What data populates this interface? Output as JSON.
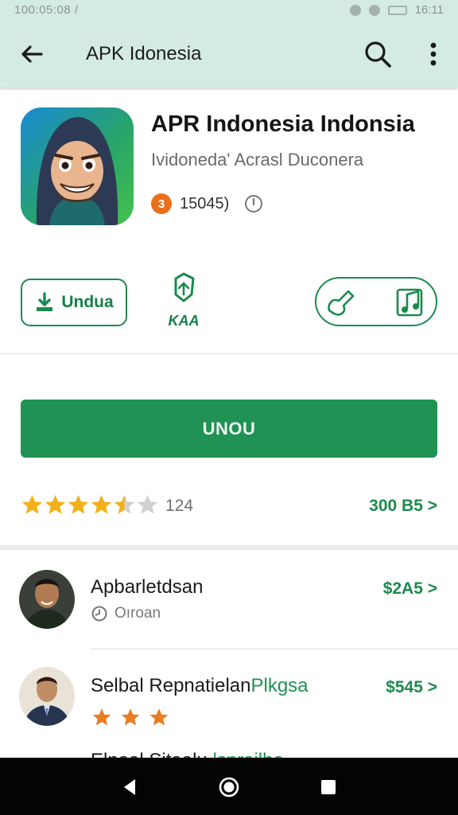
{
  "status_bar": {
    "left_text": "100:05:08  /",
    "time": "16:11"
  },
  "app_bar": {
    "title": "APK Idonesia",
    "icons": [
      "back-arrow-icon",
      "search-icon",
      "more-vert-icon"
    ]
  },
  "app": {
    "name": "APR Indonesia Indonsia",
    "developer": "Ividoneda' Acrasl Duconera",
    "age_badge": "3",
    "meta_text": "15045)",
    "colors": {
      "accent": "#1f9254",
      "age_badge": "#e9701b"
    }
  },
  "actions": {
    "download_label": "Undua",
    "mid_label": "KAA",
    "primary_button": "UNOU"
  },
  "rating": {
    "stars": 4.5,
    "count": "124",
    "link": "300 B5 >"
  },
  "reviews": [
    {
      "name": "Apbarletdsan",
      "sub": "Oıroan",
      "price": "$2A5 >"
    },
    {
      "name": "Selbal Repnatielan",
      "tag": "Plkgsa",
      "price": "$545 >",
      "stars": 3
    },
    {
      "name": "Elnaal Sitaalu",
      "tag": "lsnrailha"
    }
  ]
}
